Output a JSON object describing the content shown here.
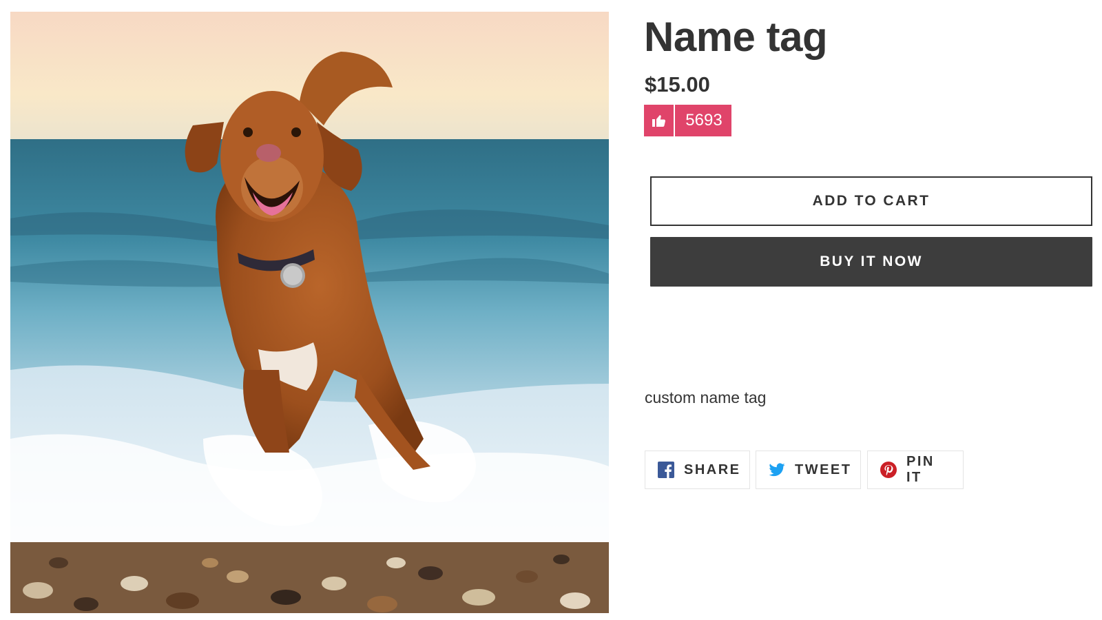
{
  "product": {
    "title": "Name tag",
    "price": "$15.00",
    "description": "custom name tag"
  },
  "likes": {
    "count": "5693",
    "icon": "thumbs-up-icon",
    "color": "#e0446a"
  },
  "actions": {
    "add_to_cart_label": "ADD TO CART",
    "buy_now_label": "BUY IT NOW"
  },
  "share": [
    {
      "label": "SHARE",
      "icon": "facebook-icon",
      "color": "#3b5998"
    },
    {
      "label": "TWEET",
      "icon": "twitter-icon",
      "color": "#1da1f2"
    },
    {
      "label": "PIN IT",
      "icon": "pinterest-icon",
      "color": "#cb2027"
    }
  ]
}
